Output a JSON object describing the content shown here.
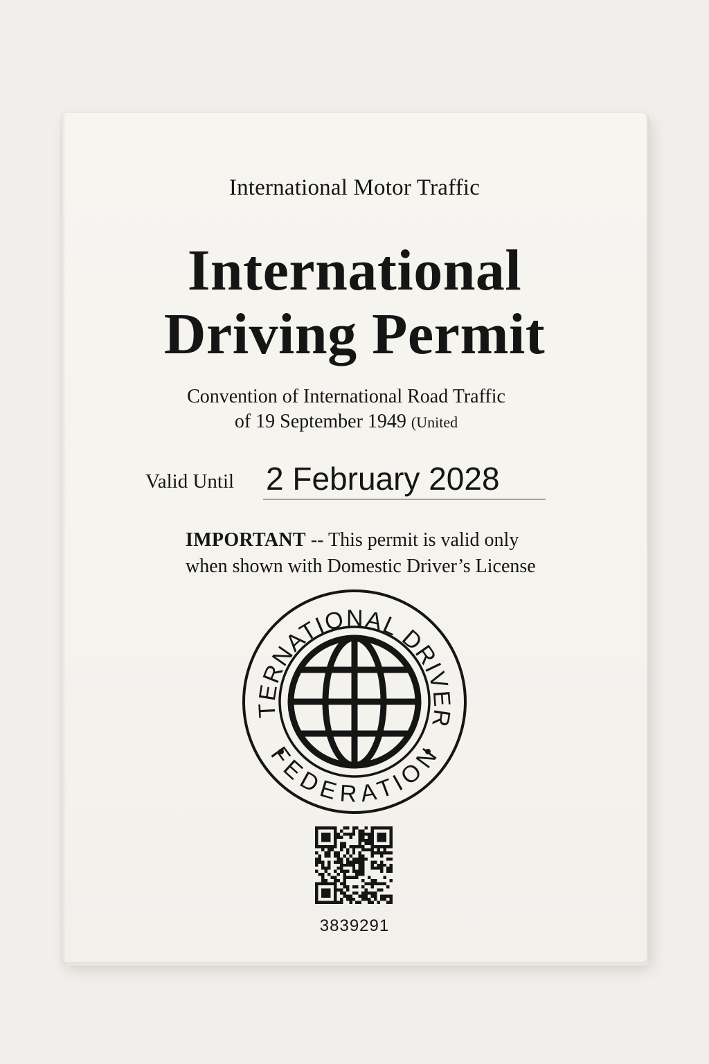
{
  "document": {
    "header": "International Motor Traffic",
    "title_line1": "International",
    "title_line2": "Driving Permit",
    "convention_line1": "Convention of International Road Traffic",
    "convention_line2_main": "of 19 September 1949 ",
    "convention_line2_small": "(United",
    "valid_label": "Valid Until",
    "valid_date": "2 February 2028",
    "important_word": "IMPORTANT",
    "important_line1_rest": " -- This permit is valid only",
    "important_line2": "when shown with Domestic Driver’s License",
    "serial_number": "3839291"
  },
  "seal": {
    "upper_text": "INTERNATIONAL DRIVERS",
    "lower_text": "FEDERATION",
    "icon": "globe-icon"
  },
  "colors": {
    "paper": "#f6f4ef",
    "background": "#f1efeb",
    "ink": "#151515"
  }
}
